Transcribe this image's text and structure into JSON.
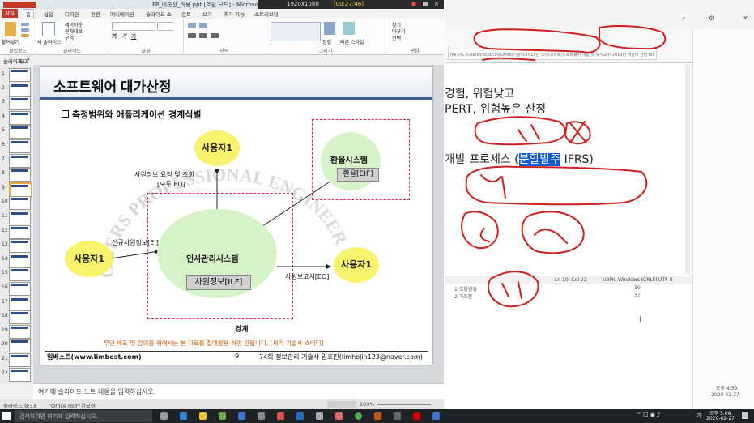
{
  "ppt": {
    "title": "FP_이숫잔_비용.ppt [호환 모드] - Microsoft PowerPoint",
    "rec_info": "1920x1080",
    "rec_time": "[00:27:46]",
    "tabs": [
      "파일",
      "홈",
      "삽입",
      "디자인",
      "전환",
      "애니메이션",
      "슬라이드 쇼",
      "검토",
      "보기",
      "추가 기능",
      "스토리보딩"
    ],
    "groups": [
      "클립보드",
      "슬라이드",
      "글꼴",
      "단락",
      "그리기",
      "편집"
    ],
    "ribbon_items": {
      "paste": "붙여넣기",
      "new_slide": "새 슬라이드",
      "layout": "레이아웃",
      "reset": "원래대로",
      "section": "구역",
      "arrange": "정렬",
      "quick": "빠른 스타일",
      "find": "찾기",
      "replace": "바꾸기",
      "select": "선택"
    },
    "ruler_tabs": [
      "슬라이드",
      "개요"
    ],
    "slide_numbers": [
      "1",
      "2",
      "3",
      "4",
      "5",
      "6",
      "7",
      "8",
      "9",
      "10",
      "11",
      "12",
      "13",
      "14",
      "15",
      "16",
      "17",
      "18",
      "19",
      "20",
      "21",
      "22"
    ],
    "selected_slide": 9,
    "notes_placeholder": "여기에 슬라이드 노트 내용을 입력하십시오.",
    "status_left": "슬라이드 9/33",
    "status_theme": "\"Office 테마\"",
    "status_lang": "한국어",
    "zoom": "103%"
  },
  "slide": {
    "title": "소프트웨어 대가산정",
    "subtitle": "측정범위와 애플리케이션 경계식별",
    "user1_top": "사용자1",
    "user1_left": "사용자1",
    "user1_right": "사용자1",
    "req_label_1": "사원정보 요청 및 조회",
    "req_label_2": "[모두 EQ]",
    "env_system": "환율시스템",
    "env_eif": "환율[EIF]",
    "main_system": "인사관리시스템",
    "main_ilf": "사원정보[ILF]",
    "new_emp": "신규사원정보[EI]",
    "report": "사원보고서[EO]",
    "boundary": "경계",
    "watermark": "GGERS PROFESSIONAL ENGINEER",
    "warning": "무단 배포 및 강의를 위해서는 본 자료를 절대활용 하면 안됩니다. [세리 기술사 스터디]",
    "footer_left": "임베스트(www.limbest.com)",
    "footer_page": "9",
    "footer_right": "74회 정보관리 기술사 임호진(limhojin123@naver.com)"
  },
  "right": {
    "url": "file:///C:/Users/cloud/OneDrive/기술사/2019년 스터디/과제/소프트웨어 개발 및 유지보수/2019년 개발비 산정.txt",
    "line1": "경험, 위험낮고",
    "line2": "PERT, 위험높은 산정",
    "line3_a": "개발 프로세스 (",
    "line3_hl": "분할발주",
    "line3_b": " IFRS)",
    "status_pos": "Ln 10, Col 22",
    "status_zoom": "100%",
    "status_eol": "Windows (CRLF)",
    "status_enc": "UTF-8",
    "list1_label": "1 조회범위",
    "list1_val": "30",
    "list2_label": "2 가조분",
    "list2_val": "37",
    "cursor_glyph": "I",
    "win_clock_time": "오후 4:59",
    "win_clock_date": "2020-02-27"
  },
  "taskbar": {
    "search": "검색하려면 여기에 입력하십시오.",
    "time": "오후 5:08",
    "date": "2020-02-27",
    "ime": "가"
  },
  "colors": {
    "slide_bar": "#3d5f95",
    "oval_yellow": "#f8f36f",
    "oval_green": "#d6f2c8",
    "ink_red": "#d11f1f",
    "highlight": "#0b5bd3"
  }
}
